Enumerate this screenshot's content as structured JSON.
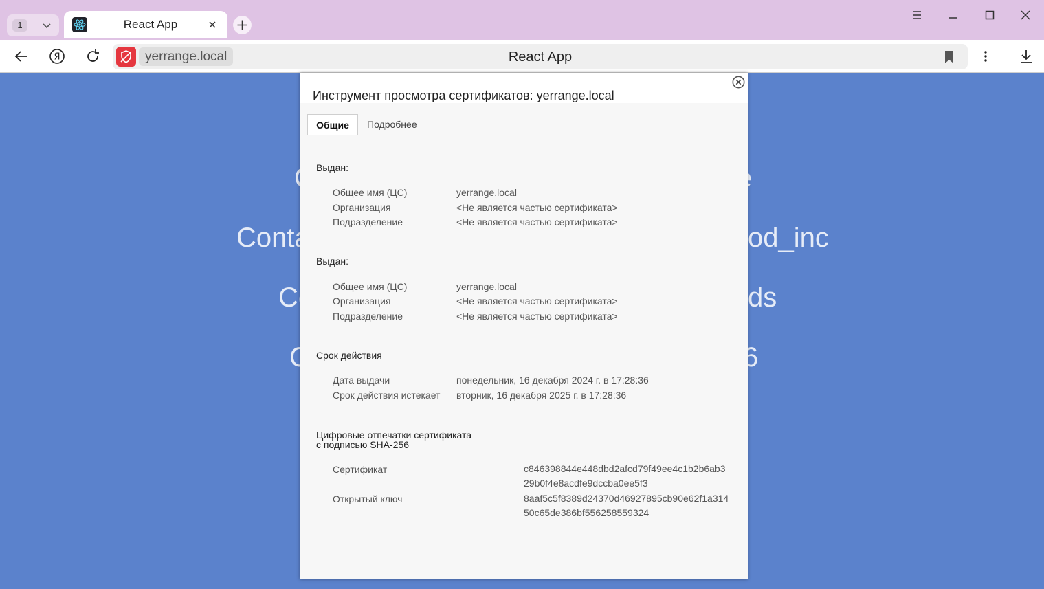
{
  "tabbar": {
    "tab_count": "1",
    "active_tab_title": "React App"
  },
  "toolbar": {
    "domain": "yerrange.local",
    "page_title": "React App"
  },
  "page": {
    "lines": [
      "C",
      "e",
      "Conta",
      "od_inc",
      "Co",
      "ds",
      "C",
      "6"
    ]
  },
  "dialog": {
    "title": "Инструмент просмотра сертификатов: yerrange.local",
    "tabs": [
      {
        "label": "Общие"
      },
      {
        "label": "Подробнее"
      }
    ],
    "issued_to": {
      "heading": "Выдан:",
      "rows": [
        {
          "label": "Общее имя (ЦС)",
          "value": "yerrange.local"
        },
        {
          "label": "Организация",
          "value": "<Не является частью сертификата>"
        },
        {
          "label": "Подразделение",
          "value": "<Не является частью сертификата>"
        }
      ]
    },
    "issued_by": {
      "heading": "Выдан:",
      "rows": [
        {
          "label": "Общее имя (ЦС)",
          "value": "yerrange.local"
        },
        {
          "label": "Организация",
          "value": "<Не является частью сертификата>"
        },
        {
          "label": "Подразделение",
          "value": "<Не является частью сертификата>"
        }
      ]
    },
    "validity": {
      "heading": "Срок действия",
      "rows": [
        {
          "label": "Дата выдачи",
          "value": "понедельник, 16 декабря 2024 г. в 17:28:36"
        },
        {
          "label": "Срок действия истекает",
          "value": "вторник, 16 декабря 2025 г. в 17:28:36"
        }
      ]
    },
    "fingerprints": {
      "heading_line1": "Цифровые отпечатки сертификата",
      "heading_line2": "с подписью SHA-256",
      "rows": [
        {
          "label": "Сертификат",
          "line1": "c846398844e448dbd2afcd79f49ee4c1b2b6ab3",
          "line2": "29b0f4e8acdfe9dccba0ee5f3"
        },
        {
          "label": "Открытый ключ",
          "line1": "8aaf5c5f8389d24370d46927895cb90e62f1a314",
          "line2": "50c65de386bf556258559324"
        }
      ]
    }
  },
  "colors": {
    "page_background": "#5b82cc",
    "tabbar_background": "#dfc3e4",
    "security_warning": "#e5373f"
  },
  "icons": {
    "tab_favicon": "react-logo-icon",
    "tab_close": "close-icon",
    "new_tab": "plus-icon",
    "menu": "hamburger-icon",
    "minimize": "minimize-icon",
    "maximize": "maximize-icon",
    "window_close": "close-icon",
    "back": "back-arrow-icon",
    "yandex": "yandex-logo-icon",
    "reload": "reload-icon",
    "security": "not-secure-shield-icon",
    "bookmark": "bookmark-icon",
    "more": "more-vertical-icon",
    "downloads": "download-icon",
    "dialog_close": "close-circle-icon"
  }
}
